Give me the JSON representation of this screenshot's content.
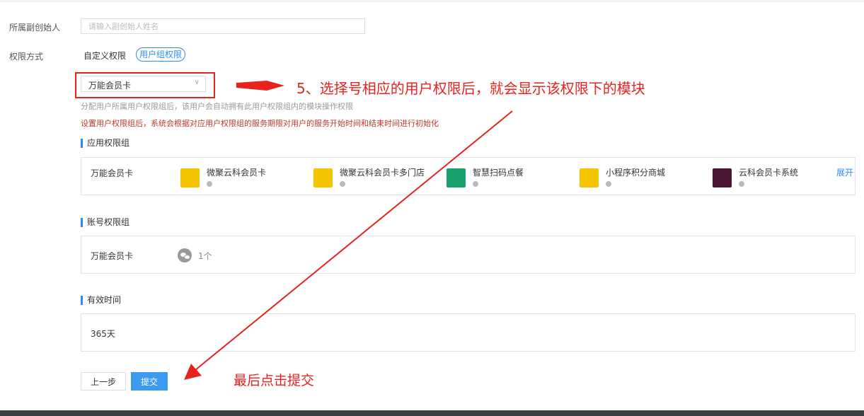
{
  "form": {
    "founder_label": "所属副创始人",
    "founder_placeholder": "请输入副创始人姓名",
    "perm_label": "权限方式",
    "mode_custom": "自定义权限",
    "mode_group": "用户组权限",
    "selected_group": "万能会员卡",
    "help_text": "分配用户所属用户权限组后，该用户会自动拥有此用户权限组内的模块操作权限",
    "warning_text": "设置用户权限组后，系统会根据对应用户权限组的服务期限对用户的服务开始时间和结束时间进行初始化"
  },
  "app_group": {
    "title": "应用权限组",
    "name": "万能会员卡",
    "expand_label": "展开",
    "modules": [
      {
        "name": "微聚云科会员卡",
        "icon": "member-card-icon",
        "color": "#f5c400"
      },
      {
        "name": "微聚云科会员卡多门店",
        "icon": "crown-card-icon",
        "color": "#f5c400"
      },
      {
        "name": "智慧扫码点餐",
        "icon": "dining-bell-icon",
        "color": "#1aa06d"
      },
      {
        "name": "小程序积分商城",
        "icon": "points-mall-icon",
        "color": "#f5c400"
      },
      {
        "name": "云科会员卡系统",
        "icon": "vip-card-icon",
        "color": "#4a1535"
      }
    ]
  },
  "account_group": {
    "title": "账号权限组",
    "name": "万能会员卡",
    "count": "1个"
  },
  "validity": {
    "title": "有效时间",
    "value": "365天"
  },
  "buttons": {
    "prev": "上一步",
    "submit": "提交"
  },
  "annotations": {
    "step5": "5、选择号相应的用户权限后，就会显示该权限下的模块",
    "final": "最后点击提交",
    "color": "#e8231e"
  }
}
